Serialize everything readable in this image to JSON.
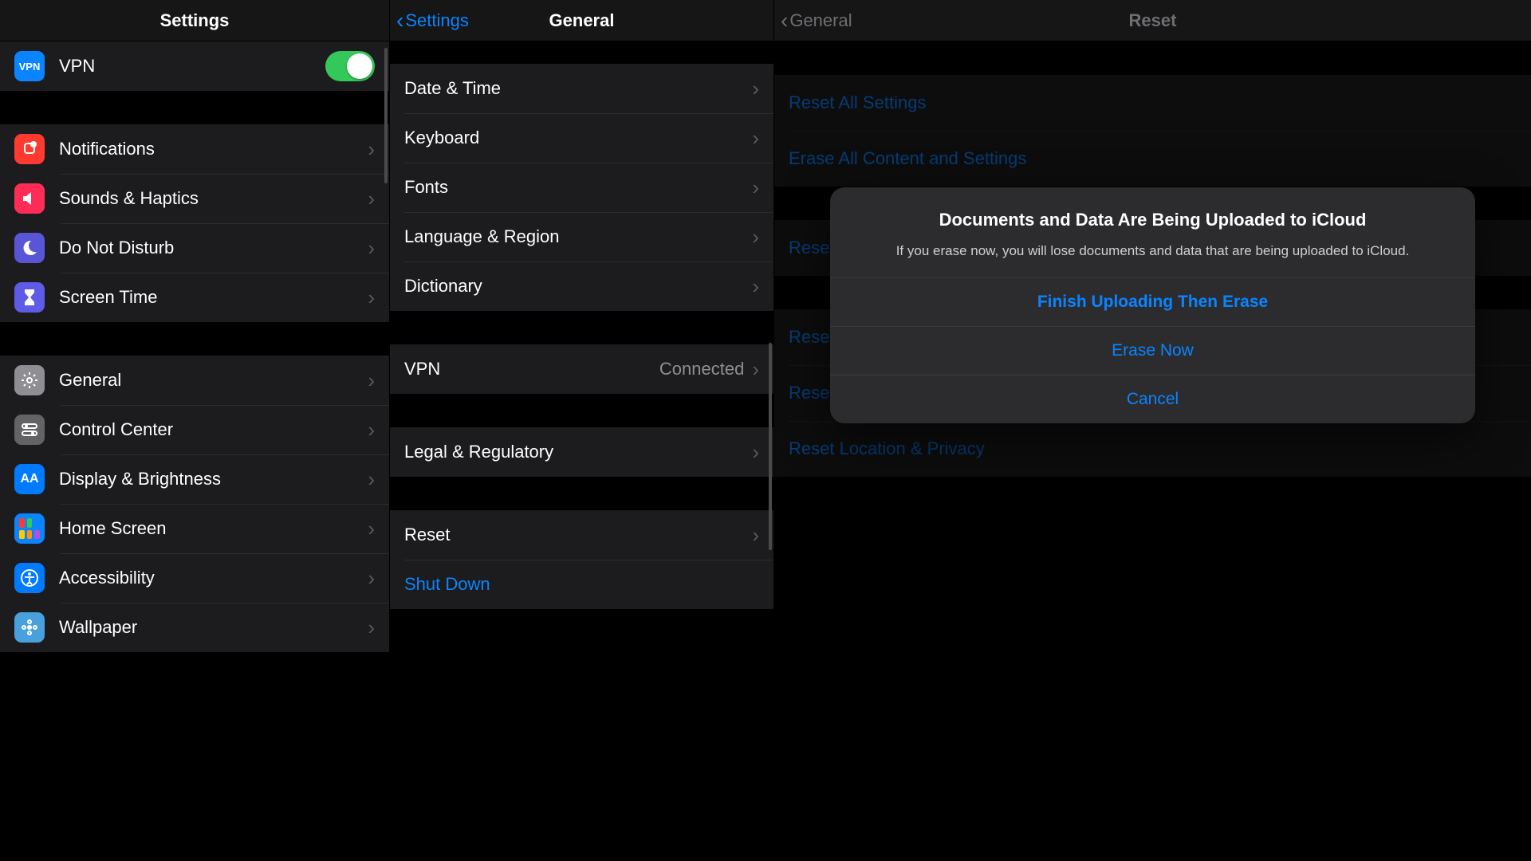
{
  "screen1": {
    "title": "Settings",
    "vpn_row": {
      "label": "VPN",
      "toggled": true
    },
    "group_a": [
      {
        "icon": "bell-icon",
        "bg": "bg-red",
        "label": "Notifications"
      },
      {
        "icon": "speaker-icon",
        "bg": "bg-pink",
        "label": "Sounds & Haptics"
      },
      {
        "icon": "moon-icon",
        "bg": "bg-purple",
        "label": "Do Not Disturb"
      },
      {
        "icon": "hourglass-icon",
        "bg": "bg-indigo",
        "label": "Screen Time"
      }
    ],
    "group_b": [
      {
        "icon": "gear-icon",
        "bg": "bg-gray",
        "label": "General"
      },
      {
        "icon": "switches-icon",
        "bg": "bg-gray2",
        "label": "Control Center"
      },
      {
        "icon": "text-size-icon",
        "bg": "bg-blue2",
        "label": "Display & Brightness"
      },
      {
        "icon": "home-grid-icon",
        "bg": "bg-blue",
        "label": "Home Screen"
      },
      {
        "icon": "person-icon",
        "bg": "bg-blue2",
        "label": "Accessibility"
      },
      {
        "icon": "flower-icon",
        "bg": "bg-cyan",
        "label": "Wallpaper"
      }
    ]
  },
  "screen2": {
    "back": "Settings",
    "title": "General",
    "group_a": [
      {
        "label": "Date & Time"
      },
      {
        "label": "Keyboard"
      },
      {
        "label": "Fonts"
      },
      {
        "label": "Language & Region"
      },
      {
        "label": "Dictionary"
      }
    ],
    "vpn_row": {
      "label": "VPN",
      "value": "Connected"
    },
    "legal_row": {
      "label": "Legal & Regulatory"
    },
    "group_c": [
      {
        "label": "Reset",
        "style": "normal"
      },
      {
        "label": "Shut Down",
        "style": "blue"
      }
    ]
  },
  "screen3": {
    "back": "General",
    "title": "Reset",
    "group_a": [
      {
        "label": "Reset All Settings"
      },
      {
        "label": "Erase All Content and Settings"
      }
    ],
    "group_b": [
      {
        "label": "Reset Network Settings"
      }
    ],
    "group_c": [
      {
        "label": "Reset Keyboard Dictionary"
      },
      {
        "label": "Reset Home Screen Layout"
      },
      {
        "label": "Reset Location & Privacy"
      }
    ],
    "alert": {
      "title": "Documents and Data Are Being Uploaded to iCloud",
      "message": "If you erase now, you will lose documents and data that are being uploaded to iCloud.",
      "primary": "Finish Uploading Then Erase",
      "secondary": "Erase Now",
      "cancel": "Cancel"
    }
  },
  "colors": {
    "accent": "#0a84ff",
    "toggle_on": "#34c759"
  }
}
